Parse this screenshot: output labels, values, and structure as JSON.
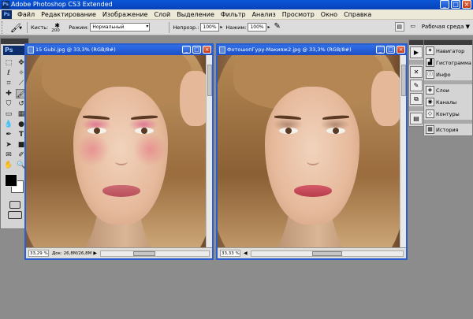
{
  "app": {
    "title": "Adobe Photoshop CS3 Extended",
    "logo": "Ps"
  },
  "menu": [
    "Файл",
    "Редактирование",
    "Изображение",
    "Слой",
    "Выделение",
    "Фильтр",
    "Анализ",
    "Просмотр",
    "Окно",
    "Справка"
  ],
  "options": {
    "brush_label": "Кисть:",
    "brush_size": "200",
    "mode_label": "Режим:",
    "mode_value": "Нормальный",
    "opacity_label": "Непрозр.:",
    "opacity_value": "100%",
    "flow_label": "Нажим:",
    "flow_value": "100%",
    "workspace_label": "Рабочая среда ▼"
  },
  "documents": [
    {
      "title": "15 Gubi.jpg @ 33,3% (RGB/8#)",
      "zoom": "33,29 %",
      "status": "Док: 26,8M/26,8M"
    },
    {
      "title": "ФотошопГуру-Макияж2.jpg @ 33,3% (RGB/8#)",
      "zoom": "33,33 %"
    }
  ],
  "panels": {
    "group1": [
      "Навигатор",
      "Гистограмма",
      "Инфо"
    ],
    "group2": [
      "Слои",
      "Каналы",
      "Контуры"
    ],
    "group3": [
      "История"
    ]
  },
  "colors": {
    "foreground": "#000000",
    "background": "#ffffff",
    "titlebar": "#0a57d8"
  }
}
